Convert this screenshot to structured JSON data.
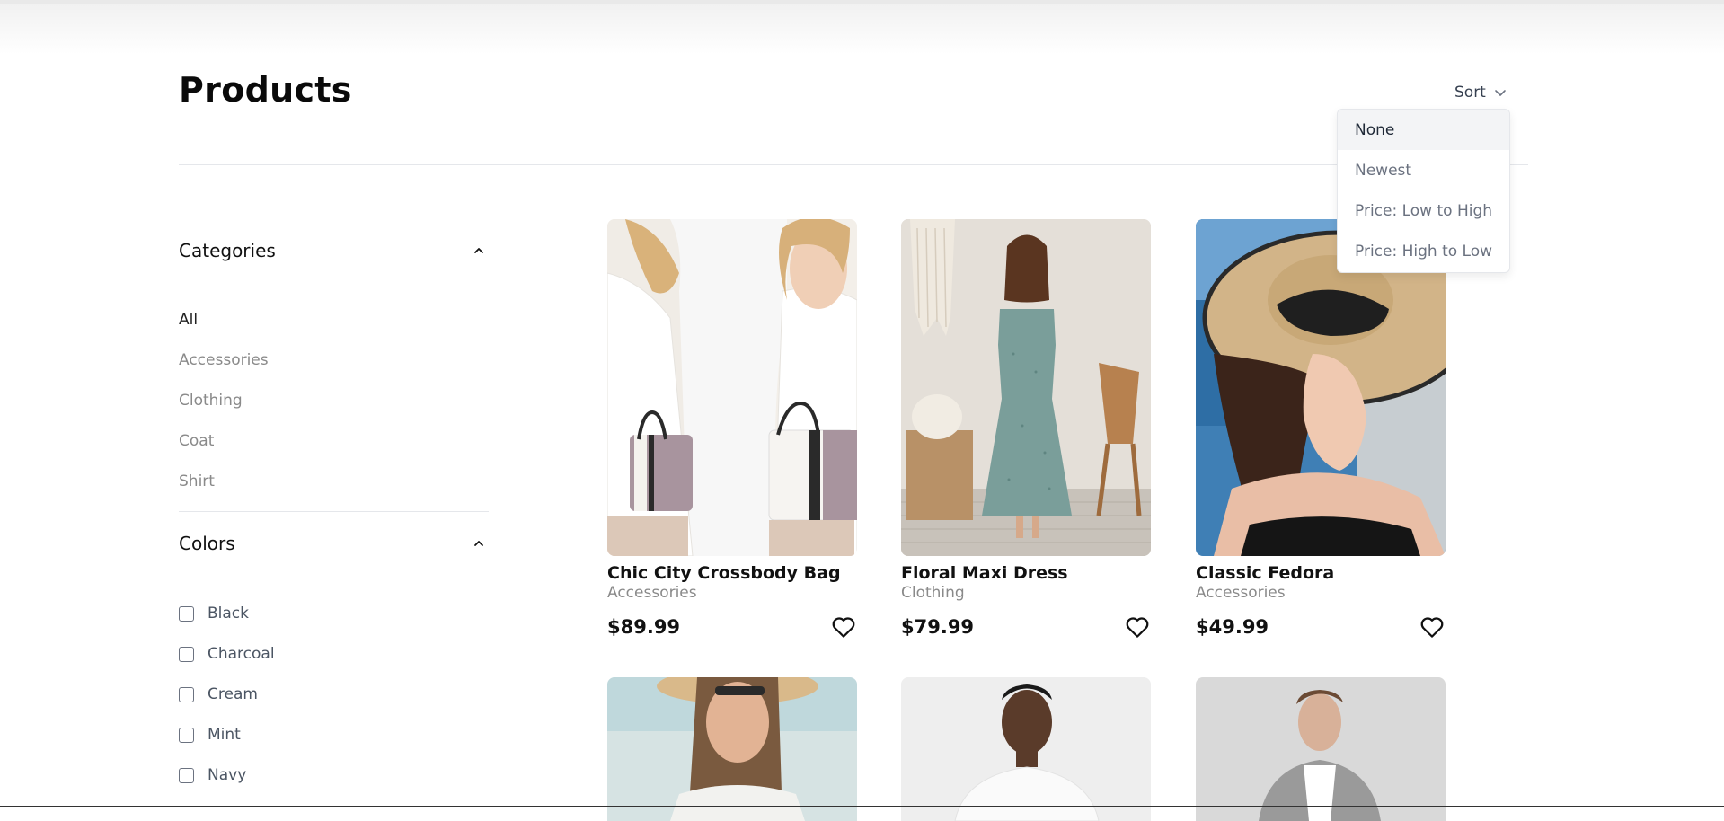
{
  "header": {
    "title": "Products",
    "sort_label": "Sort"
  },
  "sort_menu": {
    "options": [
      "None",
      "Newest",
      "Price: Low to High",
      "Price: High to Low"
    ],
    "selected": "None"
  },
  "sidebar": {
    "categories": {
      "title": "Categories",
      "items": [
        "All",
        "Accessories",
        "Clothing",
        "Coat",
        "Shirt"
      ],
      "active": "All"
    },
    "colors": {
      "title": "Colors",
      "items": [
        "Black",
        "Charcoal",
        "Cream",
        "Mint",
        "Navy"
      ]
    }
  },
  "products": [
    {
      "name": "Chic City Crossbody Bag",
      "category": "Accessories",
      "price": "$89.99"
    },
    {
      "name": "Floral Maxi Dress",
      "category": "Clothing",
      "price": "$79.99"
    },
    {
      "name": "Classic Fedora",
      "category": "Accessories",
      "price": "$49.99"
    }
  ],
  "icons": {
    "sort": "chevron-down-icon",
    "collapse": "chevron-up-icon",
    "wishlist": "heart-icon"
  }
}
